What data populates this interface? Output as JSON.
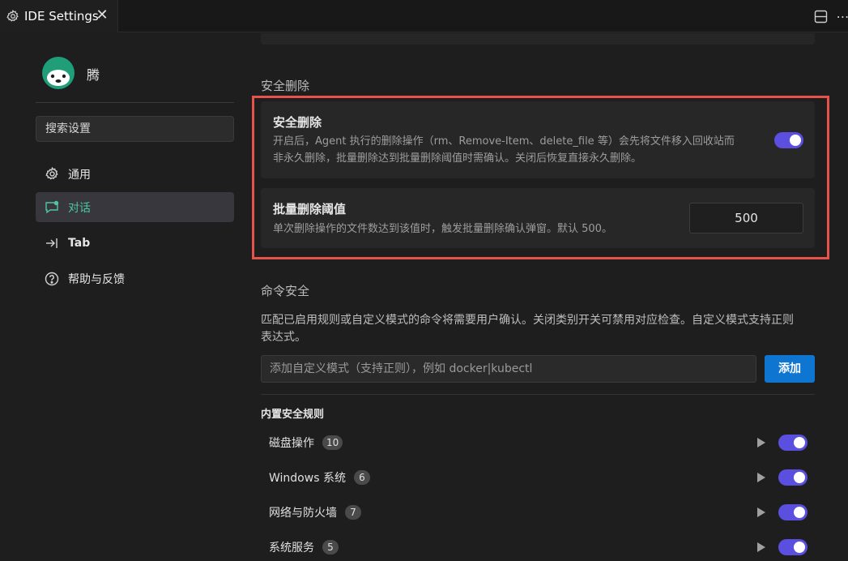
{
  "tab": {
    "title": "IDE Settings",
    "close_glyph": "✕",
    "icon": "gear-icon"
  },
  "toolbar": {
    "split_icon": "split-editor-icon",
    "more_glyph": "⋯"
  },
  "sidebar": {
    "username": "腾",
    "search_placeholder": "搜索设置",
    "items": [
      {
        "label": "通用",
        "icon": "gear-icon",
        "active": false
      },
      {
        "label": "对话",
        "icon": "chat-icon",
        "active": true
      },
      {
        "label": "Tab",
        "icon": "tab-arrow-icon",
        "active": false
      },
      {
        "label": "帮助与反馈",
        "icon": "help-icon",
        "active": false
      }
    ]
  },
  "safe_delete": {
    "section_title": "安全删除",
    "toggle_card": {
      "title": "安全删除",
      "desc_line1": "开启后，Agent 执行的删除操作（rm、Remove-Item、delete_file 等）会先将文件移入回收站而",
      "desc_line2": "非永久删除，批量删除达到批量删除阈值时需确认。关闭后恢复直接永久删除。",
      "enabled": true
    },
    "threshold_card": {
      "title": "批量删除阈值",
      "desc": "单次删除操作的文件数达到该值时，触发批量删除确认弹窗。默认 500。",
      "value": "500"
    }
  },
  "command_safety": {
    "section_title": "命令安全",
    "desc_line1": "匹配已启用规则或自定义模式的命令将需要用户确认。关闭类别开关可禁用对应检查。自定义模式支持正则",
    "desc_line2": "表达式。",
    "pattern_placeholder": "添加自定义模式（支持正则），例如 docker|kubectl",
    "add_label": "添加",
    "builtin_title": "内置安全规则",
    "rules": [
      {
        "name": "磁盘操作",
        "count": "10",
        "enabled": true
      },
      {
        "name": "Windows 系统",
        "count": "6",
        "enabled": true
      },
      {
        "name": "网络与防火墙",
        "count": "7",
        "enabled": true
      },
      {
        "name": "系统服务",
        "count": "5",
        "enabled": true
      }
    ]
  },
  "colors": {
    "accent_toggle": "#5b4fe0",
    "active_nav": "#4ec6a0",
    "primary_button": "#0e75d1",
    "highlight_border": "#e5534b"
  }
}
